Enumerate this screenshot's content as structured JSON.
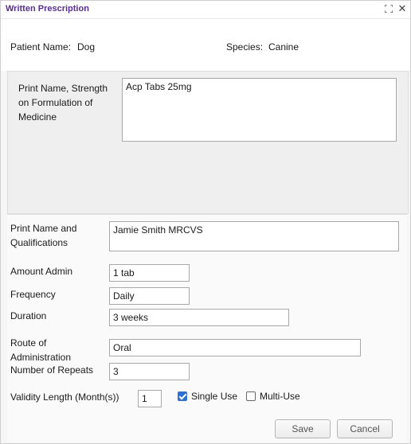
{
  "window": {
    "title": "Written Prescription"
  },
  "patient": {
    "name_label": "Patient Name:",
    "name_value": "Dog",
    "species_label": "Species:",
    "species_value": "Canine"
  },
  "formulation": {
    "label": "Print Name, Strength on Formulation of Medicine",
    "value": "Acp Tabs 25mg"
  },
  "qualifications": {
    "label": "Print Name and Qualifications",
    "value": "Jamie Smith MRCVS"
  },
  "amount_admin": {
    "label": "Amount Admin",
    "value": "1 tab"
  },
  "frequency": {
    "label": "Frequency",
    "value": "Daily"
  },
  "duration": {
    "label": "Duration",
    "value": "3 weeks"
  },
  "route": {
    "label": "Route of Administration",
    "value": "Oral"
  },
  "repeats": {
    "label": "Number of Repeats",
    "value": "3"
  },
  "validity": {
    "label": "Validity Length (Month(s))",
    "value": "1"
  },
  "single_use": {
    "label": "Single Use",
    "checked": true
  },
  "multi_use": {
    "label": "Multi-Use",
    "checked": false
  },
  "buttons": {
    "save": "Save",
    "cancel": "Cancel"
  },
  "colors": {
    "title": "#5a2d91",
    "checkbox_checked": "#2f6fd6"
  },
  "icons": {
    "expand": "expand-icon",
    "close": "close-icon"
  }
}
